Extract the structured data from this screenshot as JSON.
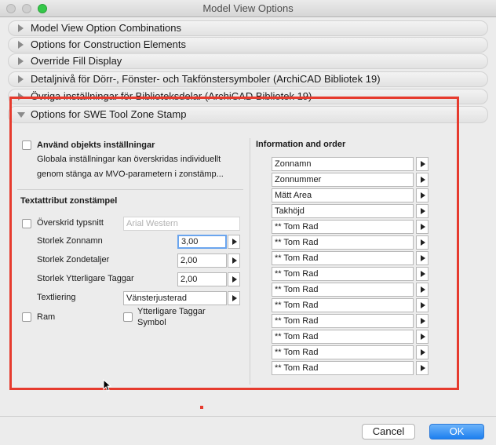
{
  "window": {
    "title": "Model View Options"
  },
  "sections": [
    {
      "label": "Model View Option Combinations"
    },
    {
      "label": "Options for Construction Elements"
    },
    {
      "label": "Override Fill Display"
    },
    {
      "label": "Detaljnivå för Dörr-, Fönster- och Takfönstersymboler (ArchiCAD Bibliotek 19)"
    },
    {
      "label": "Övriga inställningar för Biblioteksdelar (ArchiCAD Bibliotek 19)"
    }
  ],
  "expanded_section": {
    "label": "Options for SWE Tool Zone Stamp"
  },
  "left": {
    "use_object_settings": "Använd objekts inställningar",
    "global_note_line1": "Globala inställningar kan överskridas individuellt",
    "global_note_line2": "genom stänga av MVO-parametern i zonstämp...",
    "text_attr_heading": "Textattribut zonstämpel",
    "override_font_label": "Överskrid typsnitt",
    "font_value": "Arial Western",
    "size_zone_name_label": "Storlek Zonnamn",
    "size_zone_name_value": "3,00",
    "size_zone_details_label": "Storlek Zondetaljer",
    "size_zone_details_value": "2,00",
    "size_additional_tags_label": "Storlek Ytterligare Taggar",
    "size_additional_tags_value": "2,00",
    "text_alignment_label": "Textliering",
    "text_alignment_value": "Vänsterjusterad",
    "frame_label": "Ram",
    "additional_tags_symbol_line1": "Ytterligare Taggar",
    "additional_tags_symbol_line2": "Symbol"
  },
  "right": {
    "heading": "Information and order",
    "items": [
      "Zonnamn",
      "Zonnummer",
      "Mätt Area",
      "Takhöjd",
      "** Tom Rad",
      "** Tom Rad",
      "** Tom Rad",
      "** Tom Rad",
      "** Tom Rad",
      "** Tom Rad",
      "** Tom Rad",
      "** Tom Rad",
      "** Tom Rad",
      "** Tom Rad"
    ]
  },
  "buttons": {
    "cancel": "Cancel",
    "ok": "OK"
  }
}
